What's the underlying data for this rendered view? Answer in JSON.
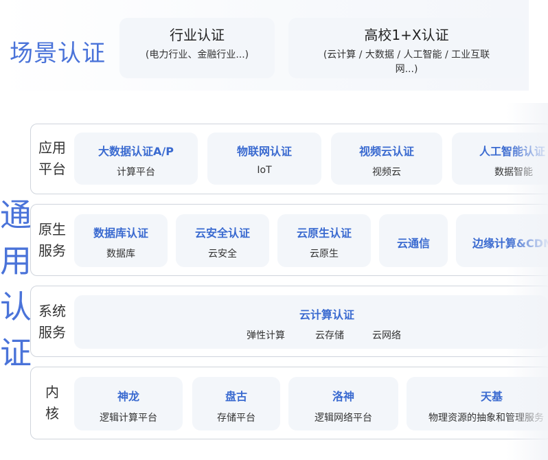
{
  "scene": {
    "title": "场景认证",
    "cards": [
      {
        "title": "行业认证",
        "sub": "(电力行业、金融行业...)"
      },
      {
        "title": "高校1+X认证",
        "sub": "(云计算 / 大数据 / 人工智能 / 工业互联网...)"
      }
    ]
  },
  "general": {
    "chars": [
      "通",
      "用",
      "认",
      "证"
    ]
  },
  "rows": [
    {
      "label": [
        "应用",
        "平台"
      ],
      "items": [
        {
          "title": "大数据认证A/P",
          "sub": "计算平台"
        },
        {
          "title": "物联网认证",
          "sub": "IoT"
        },
        {
          "title": "视频云认证",
          "sub": "视频云"
        },
        {
          "title": "人工智能认证",
          "sub": "数据智能"
        }
      ]
    },
    {
      "label": [
        "原生",
        "服务"
      ],
      "items": [
        {
          "title": "数据库认证",
          "sub": "数据库"
        },
        {
          "title": "云安全认证",
          "sub": "云安全"
        },
        {
          "title": "云原生认证",
          "sub": "云原生"
        },
        {
          "title": "云通信",
          "sub": ""
        },
        {
          "title": "边缘计算&CDN",
          "sub": ""
        }
      ]
    },
    {
      "label": [
        "系统",
        "服务"
      ],
      "items": [
        {
          "title": "云计算认证",
          "subs": [
            "弹性计算",
            "云存储",
            "云网络"
          ]
        }
      ]
    },
    {
      "label": [
        "内",
        "核"
      ],
      "items": [
        {
          "title": "神龙",
          "sub": "逻辑计算平台"
        },
        {
          "title": "盘古",
          "sub": "存储平台"
        },
        {
          "title": "洛神",
          "sub": "逻辑网络平台"
        },
        {
          "title": "天基",
          "sub": "物理资源的抽象和管理服务"
        }
      ]
    }
  ]
}
